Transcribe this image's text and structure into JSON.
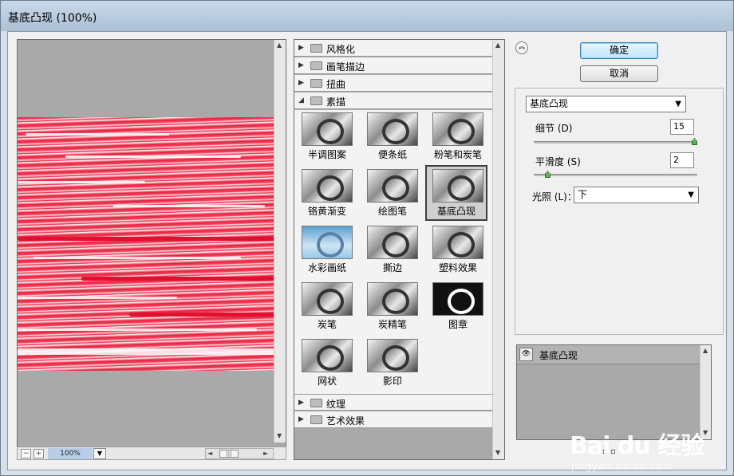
{
  "window": {
    "title": "基底凸现 (100%)"
  },
  "preview": {
    "zoom": "100%",
    "zoom_out": "−",
    "zoom_in": "+",
    "scroll_up": "▲",
    "scroll_down": "▼",
    "scroll_left": "◄",
    "scroll_right": "►",
    "thumb_grip": "|||"
  },
  "filter_list": {
    "categories_top": [
      {
        "label": "风格化",
        "expanded": false
      },
      {
        "label": "画笔描边",
        "expanded": false
      },
      {
        "label": "扭曲",
        "expanded": false
      },
      {
        "label": "素描",
        "expanded": true
      }
    ],
    "categories_bottom": [
      {
        "label": "纹理",
        "expanded": false
      },
      {
        "label": "艺术效果",
        "expanded": false
      }
    ],
    "filters": [
      {
        "name": "半调图案"
      },
      {
        "name": "便条纸"
      },
      {
        "name": "粉笔和炭笔"
      },
      {
        "name": "铬黄渐变"
      },
      {
        "name": "绘图笔"
      },
      {
        "name": "基底凸现",
        "selected": true
      },
      {
        "name": "水彩画纸"
      },
      {
        "name": "撕边"
      },
      {
        "name": "塑料效果"
      },
      {
        "name": "炭笔"
      },
      {
        "name": "炭精笔"
      },
      {
        "name": "图章"
      },
      {
        "name": "网状"
      },
      {
        "name": "影印"
      }
    ],
    "tri_closed": "▶",
    "tri_open": "◢"
  },
  "buttons": {
    "ok": "确定",
    "cancel": "取消",
    "collapse": "︽"
  },
  "settings": {
    "filter_select": "基底凸现",
    "detail_label": "细节 (D)",
    "detail_value": "15",
    "detail_fraction": 1.0,
    "smooth_label": "平滑度 (S)",
    "smooth_value": "2",
    "smooth_fraction": 0.07,
    "light_label": "光照 (L)：",
    "light_value": "下",
    "select_arrow": "▼"
  },
  "layers": {
    "items": [
      {
        "name": "基底凸现",
        "visible": true
      }
    ],
    "eye": "👁",
    "btns": "▫ ▫"
  },
  "watermark": {
    "logo": "Bai du 经验",
    "sub": "jingyan.baidu.com"
  },
  "colors": {
    "preview_red": "#e8203f",
    "accent_button": "#bee6fd"
  }
}
